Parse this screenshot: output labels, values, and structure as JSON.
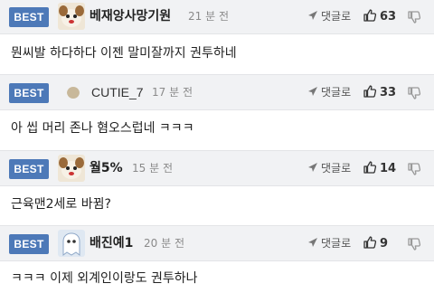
{
  "comments": [
    {
      "badge": "BEST",
      "avatar_icon": "puppy-avatar-icon",
      "nickname": "베재앙사망기원",
      "time": "21 분 전",
      "reply_label": "댓글로",
      "likes": "63",
      "text": "뭔씨발 하다하다 이젠 말미잘까지 권투하네"
    },
    {
      "badge": "BEST",
      "avatar_icon": "dot-avatar-icon",
      "nickname": "CUTIE_7",
      "time": "17 분 전",
      "reply_label": "댓글로",
      "likes": "33",
      "text": "아 씹 머리 존나 혐오스럽네 ㅋㅋㅋ"
    },
    {
      "badge": "BEST",
      "avatar_icon": "puppy-avatar-icon",
      "nickname": "월5%",
      "time": "15 분 전",
      "reply_label": "댓글로",
      "likes": "14",
      "text": "근육맨2세로 바뀜?"
    },
    {
      "badge": "BEST",
      "avatar_icon": "ghost-avatar-icon",
      "nickname": "배진예1",
      "time": "20 분 전",
      "reply_label": "댓글로",
      "likes": "9",
      "text": "ㅋㅋㅋ 이제 외계인이랑도 권투하나"
    }
  ],
  "colors": {
    "badge": "#4d79b8",
    "header_bg": "#f1f2f4",
    "time": "#8a8a8a"
  }
}
